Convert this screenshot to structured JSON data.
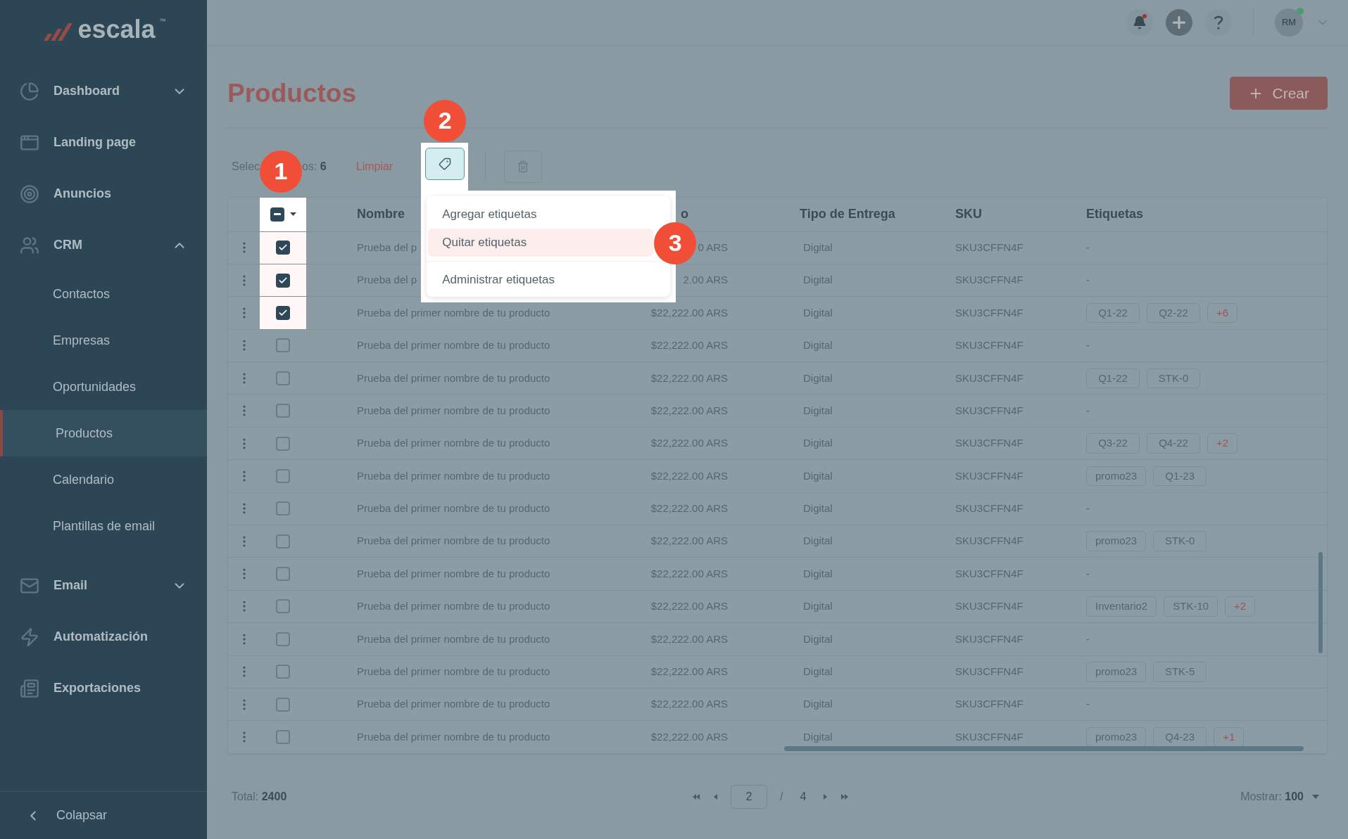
{
  "sidebar": {
    "logo": {
      "text": "escala",
      "trademark": "™"
    },
    "items": [
      {
        "kind": "group",
        "label": "Dashboard",
        "expanded": false
      },
      {
        "kind": "link",
        "label": "Landing page"
      },
      {
        "kind": "link",
        "label": "Anuncios"
      },
      {
        "kind": "group",
        "label": "CRM",
        "expanded": true,
        "children": [
          {
            "label": "Contactos",
            "selected": false
          },
          {
            "label": "Empresas",
            "selected": false
          },
          {
            "label": "Oportunidades",
            "selected": false
          },
          {
            "label": "Productos",
            "selected": true
          },
          {
            "label": "Calendario",
            "selected": false
          },
          {
            "label": "Plantillas de email",
            "selected": false
          }
        ]
      },
      {
        "kind": "group",
        "label": "Email",
        "expanded": false
      },
      {
        "kind": "link",
        "label": "Automatización"
      },
      {
        "kind": "link",
        "label": "Exportaciones"
      }
    ],
    "collapse": "Colapsar"
  },
  "topbar": {
    "notification": true,
    "avatar": "RM",
    "online": true
  },
  "page": {
    "title": "Productos",
    "create_button": "Crear"
  },
  "toolbar": {
    "selection_start": "Selec",
    "selection_end": "os:",
    "selection_count": "6",
    "clear": "Limpiar"
  },
  "callouts": [
    "1",
    "2",
    "3"
  ],
  "tag_menu": {
    "items": [
      {
        "label": "Agregar etiquetas",
        "selected": false
      },
      {
        "label": "Quitar etiquetas",
        "selected": true
      },
      {
        "label": "Administrar etiquetas",
        "selected": false
      }
    ]
  },
  "table": {
    "header_checkbox": {
      "checked": true,
      "partial": true
    },
    "columns": [
      "Nombre",
      "o",
      "Tipo de Entrega",
      "SKU",
      "Etiquetas"
    ],
    "rows": [
      {
        "selected": true,
        "name": "Prueba del p",
        "price": "0 ARS",
        "delivery": "Digital",
        "sku": "SKU3CFFN4F",
        "tags_text": "-"
      },
      {
        "selected": true,
        "name": "Prueba del p",
        "price": "2.00 ARS",
        "delivery": "Digital",
        "sku": "SKU3CFFN4F",
        "tags_text": "-"
      },
      {
        "selected": true,
        "name": "Prueba del primer nombre de tu producto",
        "price": "$22,222.00 ARS",
        "delivery": "Digital",
        "sku": "SKU3CFFN4F",
        "tags": [
          {
            "kind": "tag",
            "label": "Q1-22"
          },
          {
            "kind": "tag",
            "label": "Q2-22"
          },
          {
            "kind": "more",
            "label": "+6"
          }
        ]
      },
      {
        "selected": false,
        "name": "Prueba del primer nombre de tu producto",
        "price": "$22,222.00 ARS",
        "delivery": "Digital",
        "sku": "SKU3CFFN4F",
        "tags_text": "-"
      },
      {
        "selected": false,
        "name": "Prueba del primer nombre de tu producto",
        "price": "$22,222.00 ARS",
        "delivery": "Digital",
        "sku": "SKU3CFFN4F",
        "tags": [
          {
            "kind": "tag",
            "label": "Q1-22"
          },
          {
            "kind": "tag",
            "label": "STK-0"
          }
        ]
      },
      {
        "selected": false,
        "name": "Prueba del primer nombre de tu producto",
        "price": "$22,222.00 ARS",
        "delivery": "Digital",
        "sku": "SKU3CFFN4F",
        "tags_text": "-"
      },
      {
        "selected": false,
        "name": "Prueba del primer nombre de tu producto",
        "price": "$22,222.00 ARS",
        "delivery": "Digital",
        "sku": "SKU3CFFN4F",
        "tags": [
          {
            "kind": "tag",
            "label": "Q3-22"
          },
          {
            "kind": "tag",
            "label": "Q4-22"
          },
          {
            "kind": "more",
            "label": "+2"
          }
        ]
      },
      {
        "selected": false,
        "name": "Prueba del primer nombre de tu producto",
        "price": "$22,222.00 ARS",
        "delivery": "Digital",
        "sku": "SKU3CFFN4F",
        "tags": [
          {
            "kind": "tag",
            "label": "promo23"
          },
          {
            "kind": "tag",
            "label": "Q1-23"
          }
        ]
      },
      {
        "selected": false,
        "name": "Prueba del primer nombre de tu producto",
        "price": "$22,222.00 ARS",
        "delivery": "Digital",
        "sku": "SKU3CFFN4F",
        "tags_text": "-"
      },
      {
        "selected": false,
        "name": "Prueba del primer nombre de tu producto",
        "price": "$22,222.00 ARS",
        "delivery": "Digital",
        "sku": "SKU3CFFN4F",
        "tags": [
          {
            "kind": "tag",
            "label": "promo23"
          },
          {
            "kind": "tag",
            "label": "STK-0"
          }
        ]
      },
      {
        "selected": false,
        "name": "Prueba del primer nombre de tu producto",
        "price": "$22,222.00 ARS",
        "delivery": "Digital",
        "sku": "SKU3CFFN4F",
        "tags_text": "-"
      },
      {
        "selected": false,
        "name": "Prueba del primer nombre de tu producto",
        "price": "$22,222.00 ARS",
        "delivery": "Digital",
        "sku": "SKU3CFFN4F",
        "tags": [
          {
            "kind": "tag",
            "label": "Inventario2"
          },
          {
            "kind": "tag",
            "label": "STK-10"
          },
          {
            "kind": "more",
            "label": "+2"
          }
        ]
      },
      {
        "selected": false,
        "name": "Prueba del primer nombre de tu producto",
        "price": "$22,222.00 ARS",
        "delivery": "Digital",
        "sku": "SKU3CFFN4F",
        "tags_text": "-"
      },
      {
        "selected": false,
        "name": "Prueba del primer nombre de tu producto",
        "price": "$22,222.00 ARS",
        "delivery": "Digital",
        "sku": "SKU3CFFN4F",
        "tags": [
          {
            "kind": "tag",
            "label": "promo23"
          },
          {
            "kind": "tag",
            "label": "STK-5"
          }
        ]
      },
      {
        "selected": false,
        "name": "Prueba del primer nombre de tu producto",
        "price": "$22,222.00 ARS",
        "delivery": "Digital",
        "sku": "SKU3CFFN4F",
        "tags_text": "-"
      },
      {
        "selected": false,
        "name": "Prueba del primer nombre de tu producto",
        "price": "$22,222.00 ARS",
        "delivery": "Digital",
        "sku": "SKU3CFFN4F",
        "tags": [
          {
            "kind": "tag",
            "label": "promo23"
          },
          {
            "kind": "tag",
            "label": "Q4-23"
          },
          {
            "kind": "more",
            "label": "+1"
          }
        ]
      }
    ]
  },
  "footer": {
    "total_label": "Total:",
    "total": "2400",
    "page": "2",
    "separator": "/",
    "pages": "4",
    "show_label": "Mostrar:",
    "show": "100"
  }
}
